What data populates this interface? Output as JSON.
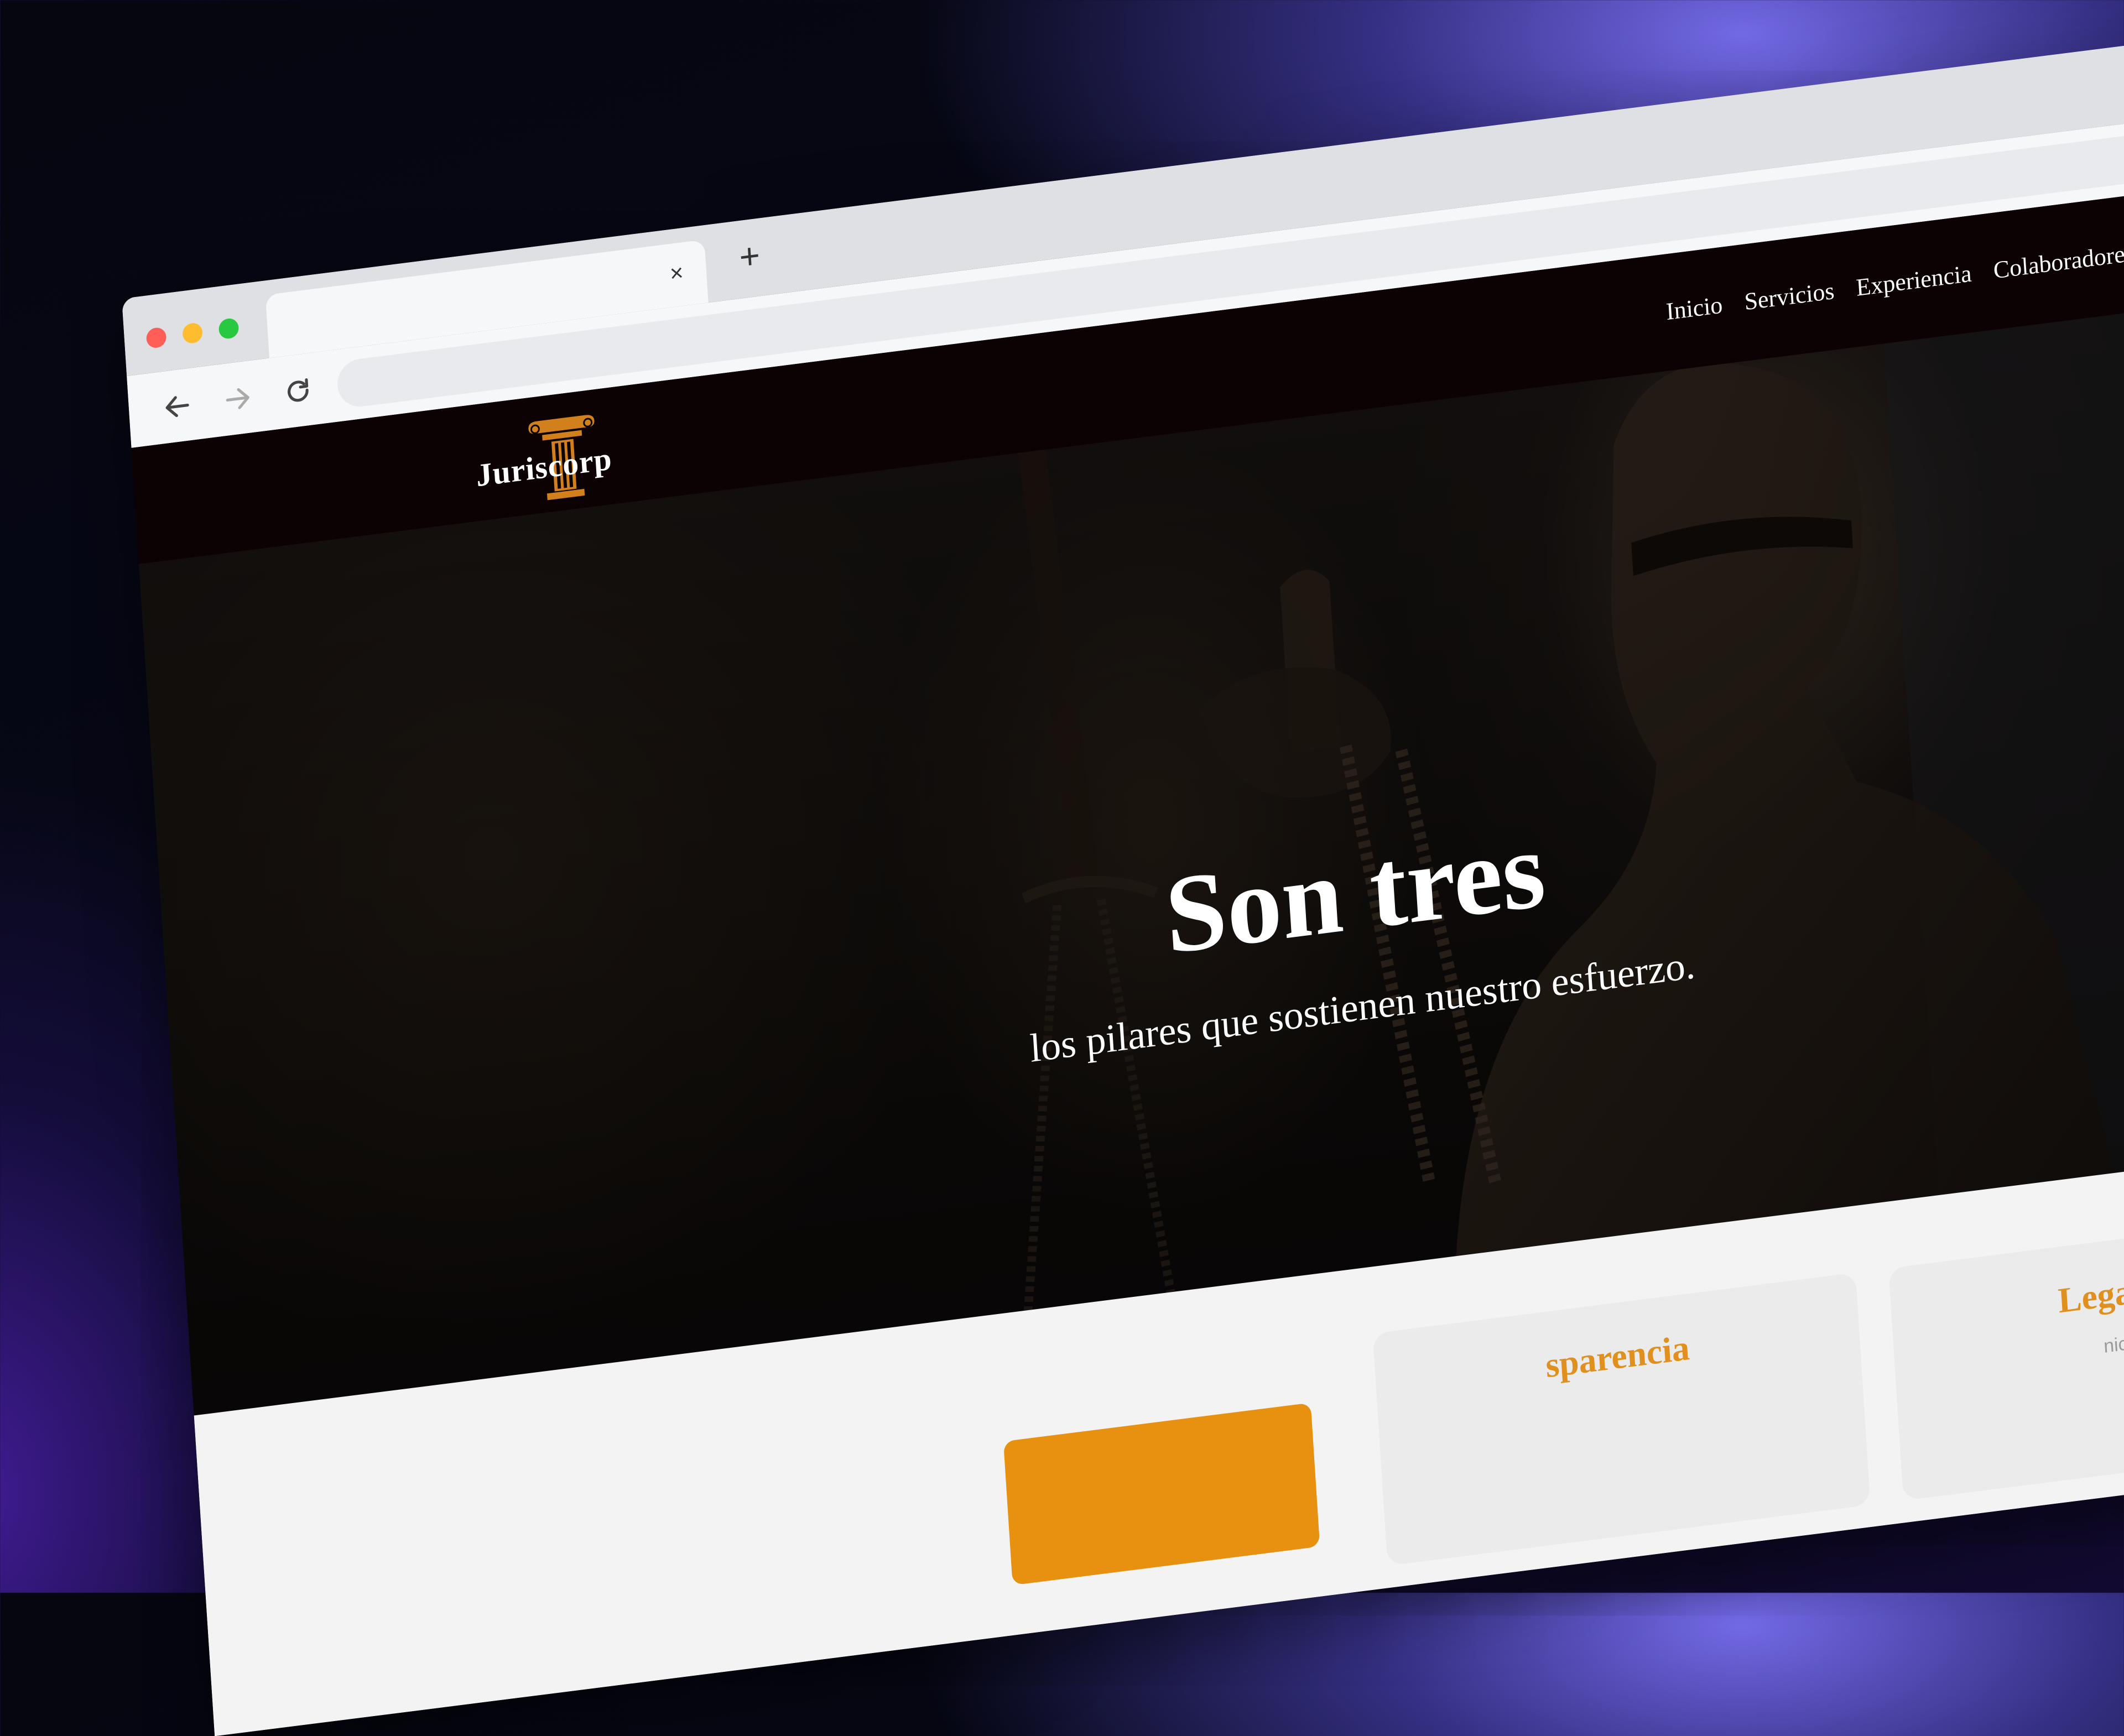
{
  "browser": {
    "tab_close": "×",
    "new_tab": "+",
    "url": ""
  },
  "site": {
    "logo_text": "Juriscorp",
    "menu": [
      {
        "label": "Inicio"
      },
      {
        "label": "Servicios"
      },
      {
        "label": "Experiencia"
      },
      {
        "label": "Colaboradore"
      }
    ],
    "hero": {
      "title": "Son tres",
      "subtitle": "los pilares que sostienen nuestro esfuerzo."
    },
    "cards": [
      {
        "title": "sparencia",
        "text": ""
      },
      {
        "title": "Legalidad",
        "text": "nico es con"
      }
    ]
  },
  "colors": {
    "accent": "#e0901e",
    "nav_bg": "#0d0203",
    "button_orange": "#e8900f"
  }
}
